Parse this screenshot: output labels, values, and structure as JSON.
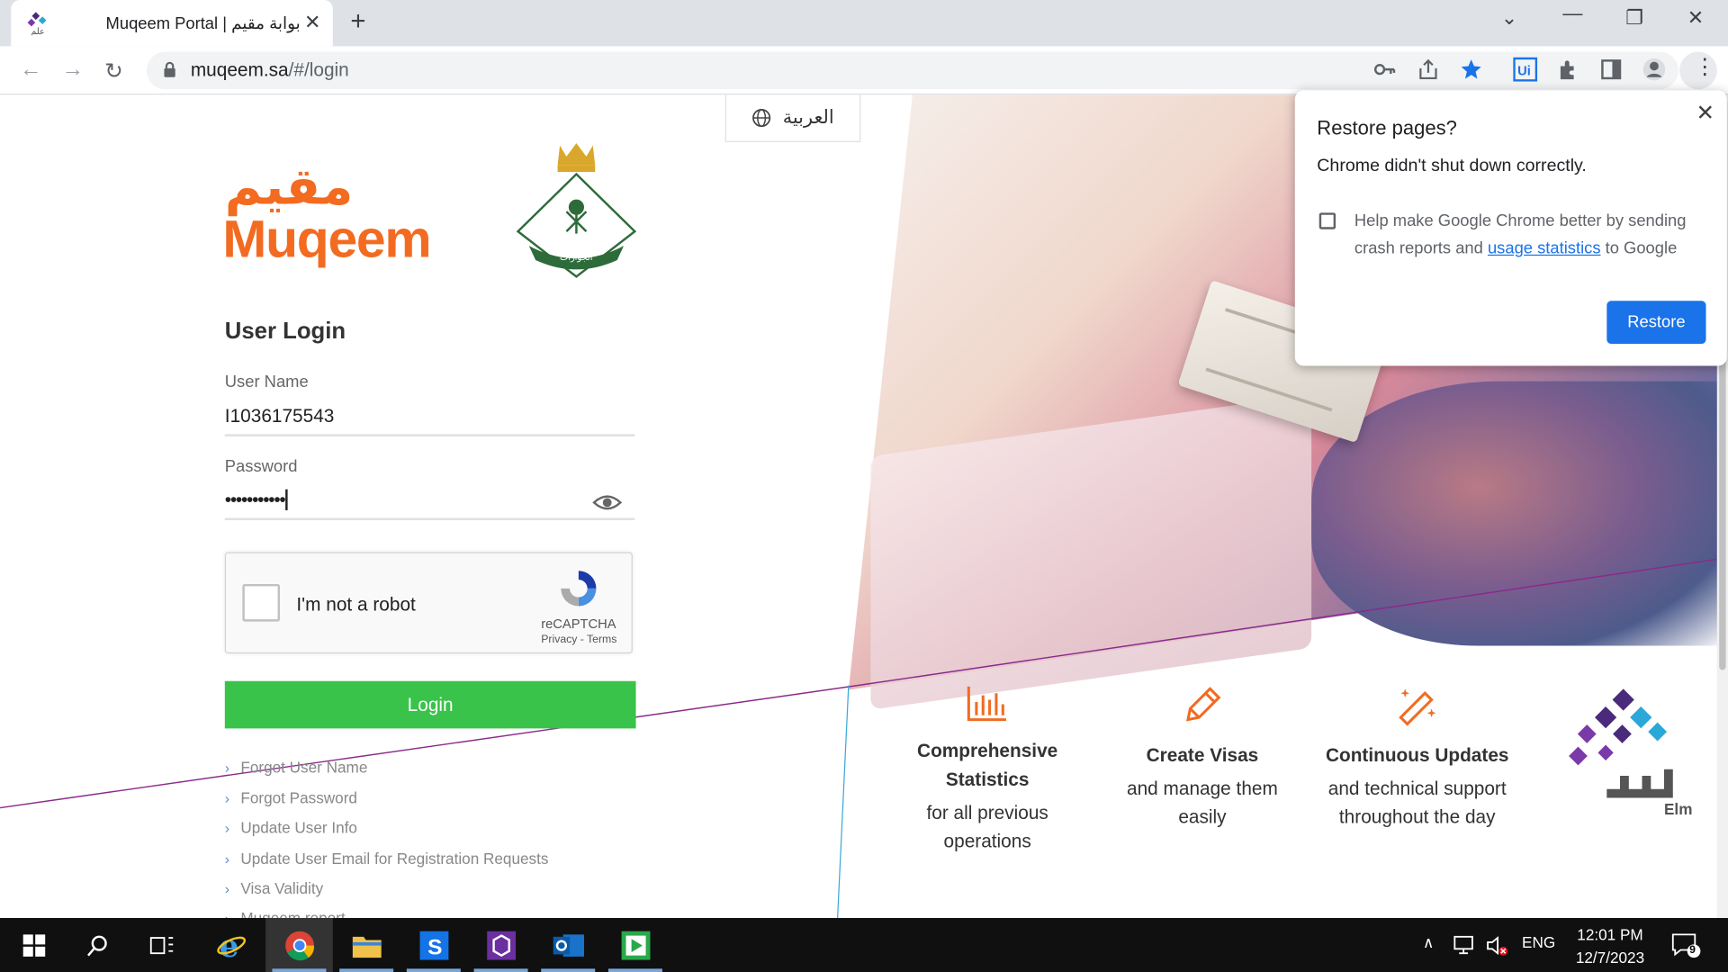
{
  "browser": {
    "tab_title": "Muqeem Portal | بوابة مقيم",
    "tab_favicon": "elm-favicon-icon",
    "url_host": "muqeem.sa",
    "url_path": "/#/login"
  },
  "page": {
    "language_button": "العربية",
    "logo_arabic": "مقيم",
    "logo_english": "Muqeem",
    "login_title": "User Login",
    "username_label": "User Name",
    "username_value": "I1036175543",
    "password_label": "Password",
    "password_value": "•••••••••••",
    "captcha_label": "I'm not a robot",
    "captcha_brand": "reCAPTCHA",
    "captcha_links": "Privacy - Terms",
    "login_button": "Login",
    "links": [
      "Forgot User Name",
      "Forgot Password",
      "Update User Info",
      "Update User Email for Registration Requests",
      "Visa Validity",
      "Muqeem report"
    ],
    "features": [
      {
        "title": "Comprehensive Statistics",
        "desc": "for all previous operations",
        "icon": "bar-chart-icon"
      },
      {
        "title": "Create Visas",
        "desc": "and manage them easily",
        "icon": "pencil-icon"
      },
      {
        "title": "Continuous Updates",
        "desc": "and technical support throughout the day",
        "icon": "magic-wand-icon"
      }
    ],
    "elm_logo_text": "Elm",
    "accent_color": "#f26b21",
    "login_button_color": "#39c34a"
  },
  "restore_popup": {
    "title": "Restore pages?",
    "message": "Chrome didn't shut down correctly.",
    "help_text_before": "Help make Google Chrome better by sending crash reports and ",
    "help_link": "usage statistics",
    "help_text_after": " to Google",
    "button": "Restore",
    "button_color": "#1a73e8"
  },
  "taskbar": {
    "language": "ENG",
    "time": "12:01 PM",
    "date": "12/7/2023",
    "notification_count": "9"
  }
}
